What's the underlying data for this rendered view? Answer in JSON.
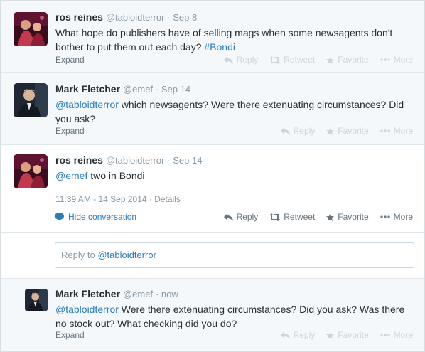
{
  "tweets": [
    {
      "name": "ros reines",
      "handle": "@tabloidterror",
      "time": "· Sep 8",
      "text": "What hope do publishers have of selling mags when some newsagents don't bother to put them out each day? ",
      "hashtag": "#Bondi",
      "expand": "Expand",
      "actions": {
        "reply": "Reply",
        "retweet": "Retweet",
        "favorite": "Favorite",
        "more": "More"
      }
    },
    {
      "name": "Mark Fletcher",
      "handle": "@emef",
      "time": "· Sep 14",
      "mention": "@tabloidterror",
      "text": " which newsagents? Were there extenuating circumstances? Did you ask?",
      "expand": "Expand",
      "actions": {
        "reply": "Reply",
        "favorite": "Favorite",
        "more": "More"
      }
    },
    {
      "name": "ros reines",
      "handle": "@tabloidterror",
      "time": "· Sep 14",
      "mention": "@emef",
      "text": " two in Bondi",
      "timestamp": "11:39 AM - 14 Sep 2014",
      "details": "· Details",
      "hide_conversation": "Hide conversation",
      "actions": {
        "reply": "Reply",
        "retweet": "Retweet",
        "favorite": "Favorite",
        "more": "More"
      }
    },
    {
      "name": "Mark Fletcher",
      "handle": "@emef",
      "time": "· now",
      "mention": "@tabloidterror",
      "text": " Were there extenuating circumstances? Did you ask? Was there no stock out? What checking did you do?",
      "expand": "Expand",
      "actions": {
        "reply": "Reply",
        "favorite": "Favorite",
        "more": "More"
      }
    }
  ],
  "reply_box": {
    "prefix": "Reply to ",
    "mention": "@tabloidterror"
  },
  "colors": {
    "link": "#2b7bb9",
    "muted": "#8899a6",
    "dim_bg": "#f5f8fa"
  }
}
